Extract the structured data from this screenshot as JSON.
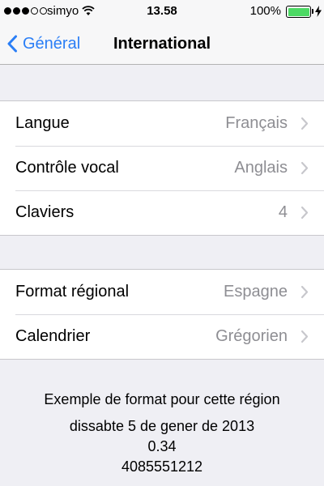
{
  "status_bar": {
    "signal_bars_filled": 3,
    "signal_bars_total": 5,
    "carrier": "simyo",
    "time": "13.58",
    "battery_percent": "100%",
    "battery_level": 1.0,
    "icons": [
      "signal-icon",
      "wifi-icon",
      "battery-icon",
      "charging-bolt-icon"
    ]
  },
  "nav": {
    "back_label": "Général",
    "title": "International"
  },
  "groups": [
    {
      "rows": [
        {
          "label": "Langue",
          "value": "Français"
        },
        {
          "label": "Contrôle vocal",
          "value": "Anglais"
        },
        {
          "label": "Claviers",
          "value": "4"
        }
      ]
    },
    {
      "rows": [
        {
          "label": "Format régional",
          "value": "Espagne"
        },
        {
          "label": "Calendrier",
          "value": "Grégorien"
        }
      ]
    }
  ],
  "example": {
    "title": "Exemple de format pour cette région",
    "date": "dissabte 5 de gener de 2013",
    "number": "0.34",
    "phone": "4085551212"
  },
  "colors": {
    "accent": "#2a7ef6",
    "background": "#efeff4",
    "value_gray": "#8e8e93",
    "battery_green": "#4cd964"
  }
}
